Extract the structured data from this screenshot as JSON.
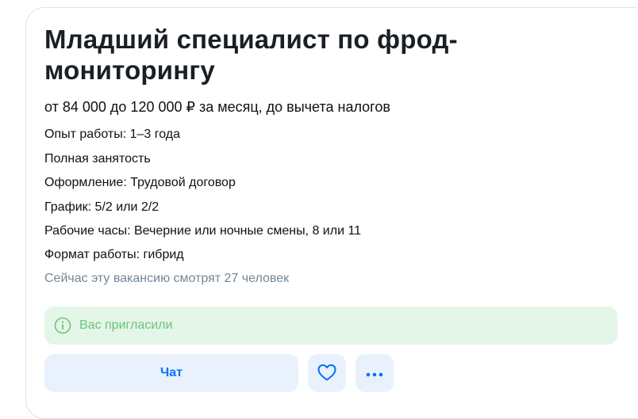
{
  "vacancy": {
    "title": "Младший специалист по фрод-мониторингу",
    "salary": "от 84 000 до 120 000 ₽ за месяц, до вычета налогов",
    "facts": [
      "Опыт работы: 1–3 года",
      "Полная занятость",
      "Оформление: Трудовой договор",
      "График: 5/2 или 2/2",
      "Рабочие часы: Вечерние или ночные смены, 8 или 11",
      "Формат работы: гибрид"
    ],
    "viewers": "Сейчас эту вакансию смотрят 27 человек"
  },
  "status": {
    "invited_label": "Вас пригласили",
    "icon": "info-icon"
  },
  "actions": {
    "chat_label": "Чат",
    "favorite_icon": "heart-icon",
    "more_icon": "more-dots-icon"
  },
  "colors": {
    "accent": "#0070ff",
    "button_bg": "#e9f2fc",
    "success_bg": "#e4f6e7",
    "success_text": "#6cc47a",
    "muted_text": "#768694"
  }
}
